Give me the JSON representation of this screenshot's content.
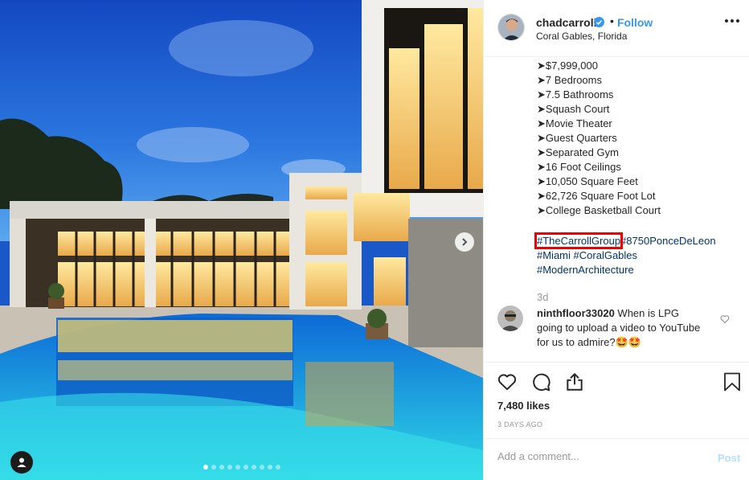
{
  "post": {
    "username": "chadcarroll",
    "separator": "•",
    "follow_label": "Follow",
    "location": "Coral Gables, Florida",
    "caption_lines": [
      "➤$7,999,000",
      "➤7 Bedrooms",
      "➤7.5 Bathrooms",
      "➤Squash Court",
      "➤Movie Theater",
      "➤Guest Quarters",
      "➤Separated Gym",
      "➤16 Foot Ceilings",
      "➤10,050 Square Feet",
      "➤62,726 Square Foot Lot",
      "➤College Basketball Court"
    ],
    "hashtags": {
      "h1": "#TheCarrollGroup",
      "h2": "#8750PonceDeLeon",
      "h3": "#Miami",
      "h4": "#CoralGables",
      "h5": "#ModernArchitecture"
    },
    "caption_time": "3d",
    "comment": {
      "username": "ninthfloor33020",
      "text": "When is LPG going to upload a video to YouTube for us to admire?🤩🤩"
    },
    "likes": "7,480 likes",
    "posted": "3 DAYS AGO",
    "add_comment_placeholder": "Add a comment...",
    "post_label": "Post",
    "carousel_total": 10,
    "carousel_active": 1
  },
  "colors": {
    "link_blue": "#3897f0",
    "hashtag": "#003569",
    "highlight": "#e00000",
    "post_disabled": "#b2dffc"
  },
  "icons": [
    "verified-badge-icon",
    "more-options-icon",
    "next-arrow-icon",
    "user-tag-icon",
    "heart-icon",
    "comment-icon",
    "share-icon",
    "bookmark-icon",
    "small-heart-icon"
  ]
}
